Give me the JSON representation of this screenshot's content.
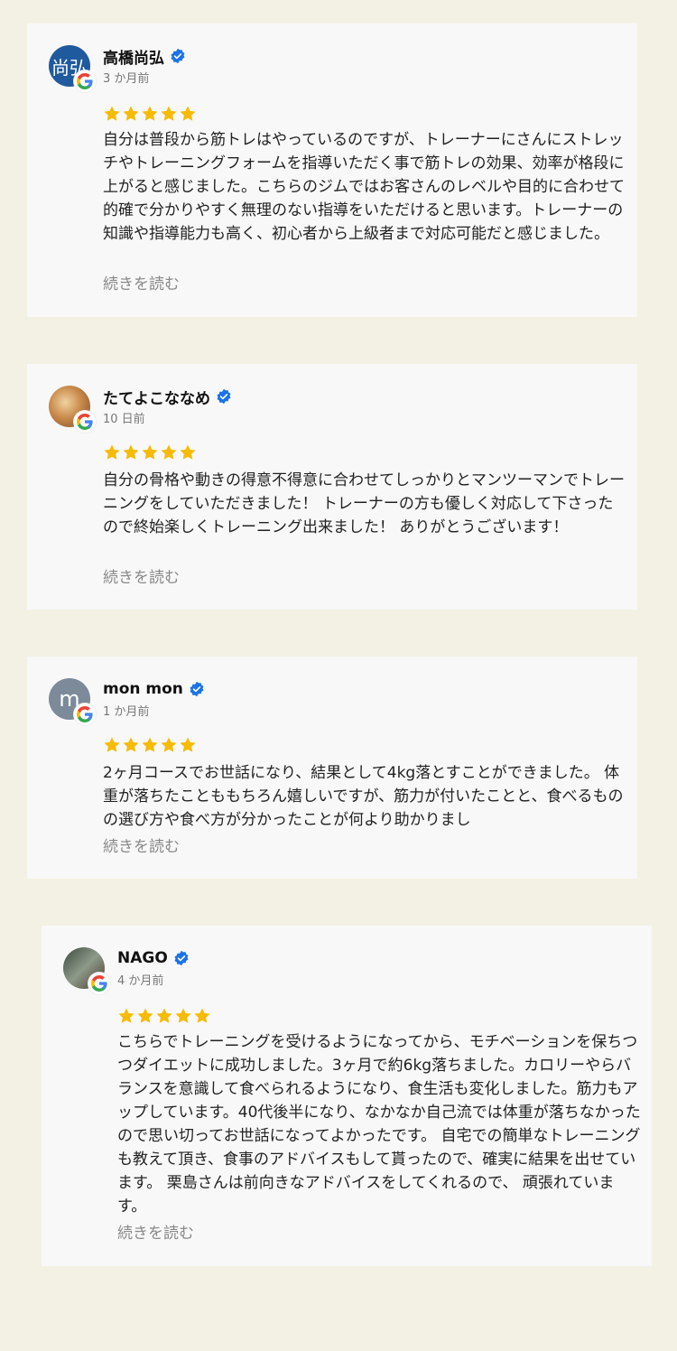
{
  "colors": {
    "page_bg": "#f3f1e3",
    "card_bg": "#f8f8f8",
    "star": "#f6bb06",
    "verified": "#1a73e8",
    "read_more": "#888888"
  },
  "icons": {
    "star": "star-icon",
    "verified": "verified-badge-icon",
    "google": "google-g-icon"
  },
  "read_more_label": "続きを読む",
  "reviews": [
    {
      "name": "高橋尚弘",
      "avatar_text": "尚弘",
      "time": "3 か月前",
      "rating": 5,
      "text": "自分は普段から筋トレはやっているのですが、トレーナーにさんにストレッチやトレーニングフォームを指導いただく事で筋トレの効果、効率が格段に上がると感じました。こちらのジムではお客さんのレベルや目的に合わせて的確で分かりやすく無理のない指導をいただけると思います。トレーナーの知識や指導能力も高く、初心者から上級者まで対応可能だと感じました。"
    },
    {
      "name": "たてよこななめ",
      "avatar_text": "",
      "time": "10 日前",
      "rating": 5,
      "text": "自分の骨格や動きの得意不得意に合わせてしっかりとマンツーマンでトレーニングをしていただきました！ トレーナーの方も優しく対応して下さったので終始楽しくトレーニング出来ました！ ありがとうございます！"
    },
    {
      "name": "mon mon",
      "avatar_text": "m",
      "time": "1 か月前",
      "rating": 5,
      "text": "2ヶ月コースでお世話になり、結果として4kg落とすことができました。 体重が落ちたことももちろん嬉しいですが、筋力が付いたことと、食べるものの選び方や食べ方が分かったことが何より助かりまし"
    },
    {
      "name": "NAGO",
      "avatar_text": "",
      "time": "4 か月前",
      "rating": 5,
      "text": "こちらでトレーニングを受けるようになってから、モチベーションを保ちつつダイエットに成功しました。3ヶ月で約6kg落ちました。カロリーやらバランスを意識して食べられるようになり、食生活も変化しました。筋力もアップしています。40代後半になり、なかなか自己流では体重が落ちなかったので思い切ってお世話になってよかったです。 自宅での簡単なトレーニングも教えて頂き、食事のアドバイスもして貰ったので、確実に結果を出せています。 栗島さんは前向きなアドバイスをしてくれるので、 頑張れています。"
    }
  ]
}
